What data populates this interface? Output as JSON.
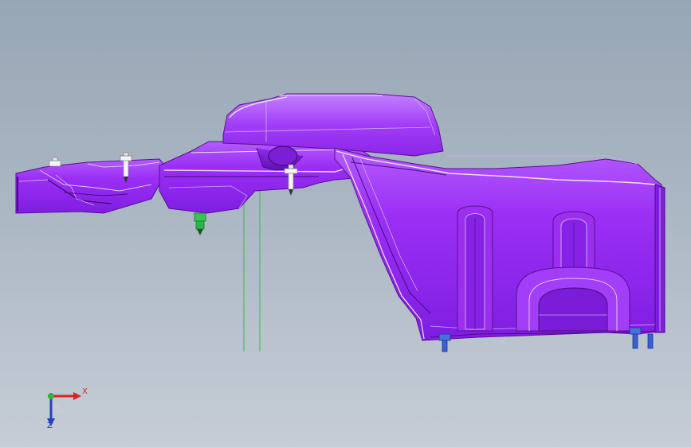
{
  "viewport": {
    "background_top": "#97a6b5",
    "background_bottom": "#c6cdd6"
  },
  "model": {
    "part_color": "#9a27f2",
    "part_edge_color": "#5a1090",
    "fastener_color": "#f0f0f0",
    "sensor_color": "#2db34a",
    "drain_bolt_color": "#3a5fd0",
    "construction_line_color": "#30c040"
  },
  "triad": {
    "x_label": "X",
    "z_label": "Z",
    "x_color": "#d8242a",
    "y_color": "#2fb33a",
    "z_color": "#2a3fbf",
    "icon": "coordinate-triad-icon"
  }
}
